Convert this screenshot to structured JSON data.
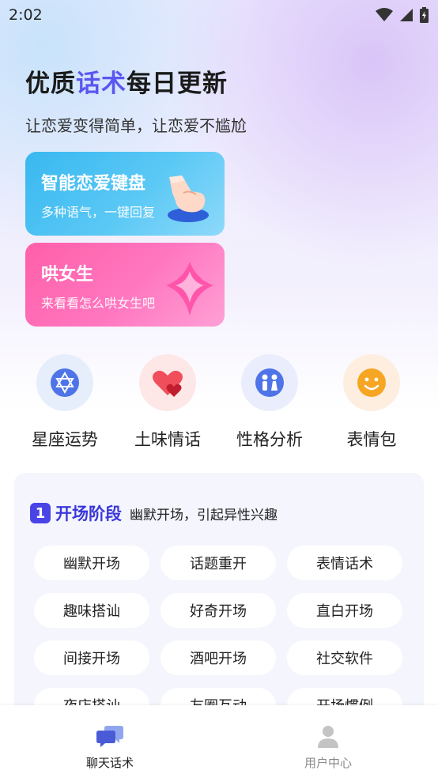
{
  "status_bar": {
    "time": "2:02"
  },
  "hero": {
    "title_part1": "优质",
    "title_highlight": "话术",
    "title_part2": "每日更新",
    "subtitle": "让恋爱变得简单，让恋爱不尴尬"
  },
  "cards": [
    {
      "title": "智能恋爱键盘",
      "desc": "多种语气，一键回复"
    },
    {
      "title": "哄女生",
      "desc": "来看看怎么哄女生吧"
    }
  ],
  "quick_actions": [
    {
      "label": "星座运势"
    },
    {
      "label": "土味情话"
    },
    {
      "label": "性格分析"
    },
    {
      "label": "表情包"
    }
  ],
  "stage": {
    "number": "1",
    "name": "开场阶段",
    "desc": "幽默开场，引起异性兴趣",
    "chips": [
      "幽默开场",
      "话题重开",
      "表情话术",
      "趣味搭讪",
      "好奇开场",
      "直白开场",
      "间接开场",
      "酒吧开场",
      "社交软件",
      "夜店搭讪",
      "友圈互动",
      "开场惯例"
    ]
  },
  "tabs": [
    {
      "label": "聊天话术"
    },
    {
      "label": "用户中心"
    }
  ],
  "colors": {
    "accent": "#5b56f0",
    "tab_active": "#4a5bd8",
    "tab_inactive": "#b5b5b5"
  }
}
